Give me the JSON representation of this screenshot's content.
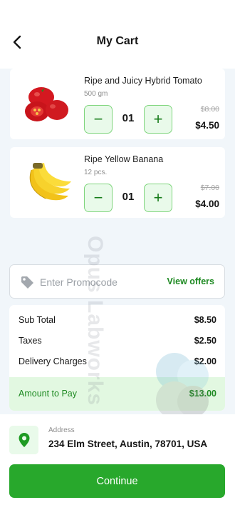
{
  "header": {
    "title": "My Cart",
    "back_icon": "chevron-left-icon"
  },
  "cart": {
    "items": [
      {
        "name": "Ripe and Juicy Hybrid Tomato",
        "qty_label": "500 gm",
        "count": "01",
        "old_price": "$8.00",
        "price": "$4.50",
        "image": "tomato-image"
      },
      {
        "name": "Ripe Yellow Banana",
        "qty_label": "12 pcs.",
        "count": "01",
        "old_price": "$7.00",
        "price": "$4.00",
        "image": "banana-image"
      }
    ],
    "minus_symbol": "−",
    "plus_symbol": "+"
  },
  "promo": {
    "placeholder": "Enter Promocode",
    "action": "View offers",
    "icon": "tag-icon"
  },
  "summary": {
    "subtotal_label": "Sub Total",
    "subtotal": "$8.50",
    "taxes_label": "Taxes",
    "taxes": "$2.50",
    "delivery_label": "Delivery Charges",
    "delivery": "$2.00",
    "total_label": "Amount to Pay",
    "total": "$13.00"
  },
  "address": {
    "label": "Address",
    "value": "234 Elm Street, Austin, 78701, USA",
    "icon": "location-pin-icon"
  },
  "continue_label": "Continue",
  "watermark": {
    "text": "Opus Labworks"
  },
  "colors": {
    "accent": "#28a82c",
    "accent_light": "#e9faea",
    "accent_text": "#1e8a22",
    "background": "#f1f6fa"
  }
}
